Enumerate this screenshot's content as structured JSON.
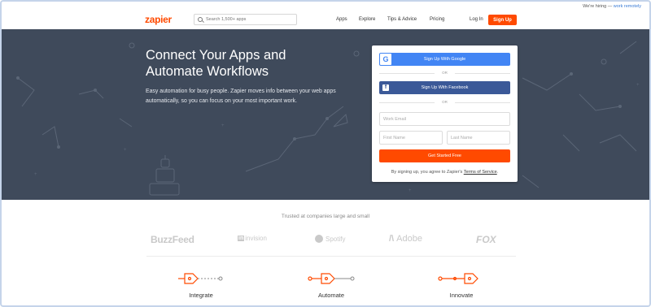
{
  "top_bar": {
    "hiring_text": "We're hiring —",
    "hiring_link": "work remotely"
  },
  "header": {
    "logo": "zapier",
    "search_placeholder": "Search 1,500+ apps",
    "nav": [
      "Apps",
      "Explore",
      "Tips & Advice",
      "Pricing"
    ],
    "login": "Log In",
    "signup": "Sign Up"
  },
  "hero": {
    "title": "Connect Your Apps and Automate Workflows",
    "description": "Easy automation for busy people. Zapier moves info between your web apps automatically, so you can focus on your most important work."
  },
  "signup_card": {
    "google_button": "Sign Up With Google",
    "or_1": "OR",
    "facebook_button": "Sign Up With Facebook",
    "or_2": "OR",
    "email_placeholder": "Work Email",
    "first_name_placeholder": "First Name",
    "last_name_placeholder": "Last Name",
    "cta_button": "Get Started Free",
    "terms_prefix": "By signing up, you agree to Zapier's",
    "terms_link": "Terms of Service",
    "terms_suffix": "."
  },
  "trusted": {
    "heading": "Trusted at companies large and small",
    "logos": [
      "BuzzFeed",
      "invision",
      "Spotify",
      "Adobe",
      "FOX"
    ]
  },
  "features": [
    {
      "label": "Integrate"
    },
    {
      "label": "Automate"
    },
    {
      "label": "Innovate"
    }
  ],
  "colors": {
    "brand": "#ff4a00",
    "hero_bg": "#3f4a5b",
    "google": "#4285f4",
    "facebook": "#3b5998"
  }
}
